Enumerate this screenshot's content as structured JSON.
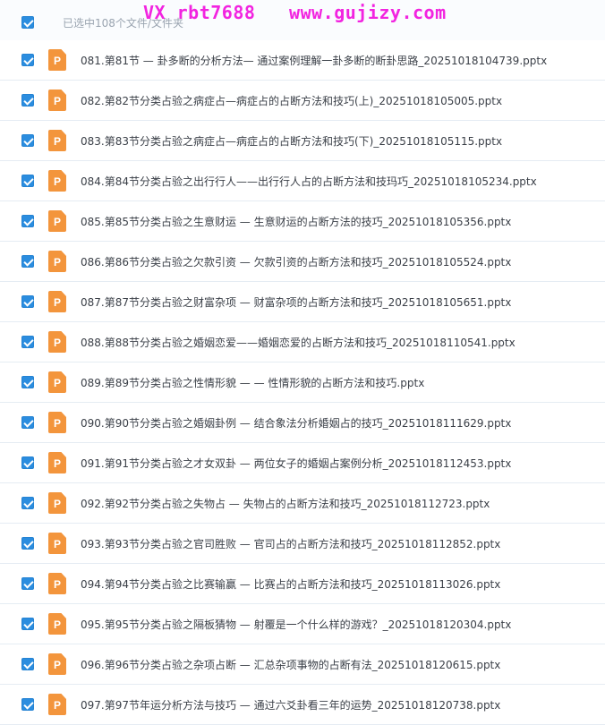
{
  "header": {
    "selected_text": "已选中108个文件/文件夹",
    "watermark": "VX rbt7688   www.gujizy.com"
  },
  "file_icon_letter": "P",
  "accent_color": "#2b8ddf",
  "icon_color": "#f3953c",
  "files": [
    {
      "name": "081.第81节 — 卦多断的分析方法— 通过案例理解一卦多断的断卦思路_20251018104739.pptx"
    },
    {
      "name": "082.第82节分类占验之病症占—病症占的占断方法和技巧(上)_20251018105005.pptx"
    },
    {
      "name": "083.第83节分类占验之病症占—病症占的占断方法和技巧(下)_20251018105115.pptx"
    },
    {
      "name": "084.第84节分类占验之出行行人——出行行人占的占断方法和技玛巧_20251018105234.pptx"
    },
    {
      "name": "085.第85节分类占验之生意财运 — 生意财运的占断方法的技巧_20251018105356.pptx"
    },
    {
      "name": "086.第86节分类占验之欠款引资 — 欠款引资的占断方法和技巧_20251018105524.pptx"
    },
    {
      "name": "087.第87节分类占验之财富杂项 — 财富杂项的占断方法和技巧_20251018105651.pptx"
    },
    {
      "name": "088.第88节分类占验之婚姻恋爱——婚姻恋爱的占断方法和技巧_20251018110541.pptx"
    },
    {
      "name": "089.第89节分类占验之性情形貌 — — 性情形貌的占断方法和技巧.pptx"
    },
    {
      "name": "090.第90节分类占验之婚姻卦例 — 结合象法分析婚姻占的技巧_20251018111629.pptx"
    },
    {
      "name": "091.第91节分类占验之才女双卦 — 两位女子的婚姻占案例分析_20251018112453.pptx"
    },
    {
      "name": "092.第92节分类占验之失物占 — 失物占的占断方法和技巧_20251018112723.pptx"
    },
    {
      "name": "093.第93节分类占验之官司胜败 — 官司占的占断方法和技巧_20251018112852.pptx"
    },
    {
      "name": "094.第94节分类占验之比赛输赢 — 比赛占的占断方法和技巧_20251018113026.pptx"
    },
    {
      "name": "095.第95节分类占验之隔板猜物 — 射覆是一个什么样的游戏？_20251018120304.pptx"
    },
    {
      "name": "096.第96节分类占验之杂项占断 — 汇总杂项事物的占断有法_20251018120615.pptx"
    },
    {
      "name": "097.第97节年运分析方法与技巧 — 通过六爻卦看三年的运势_20251018120738.pptx"
    }
  ]
}
